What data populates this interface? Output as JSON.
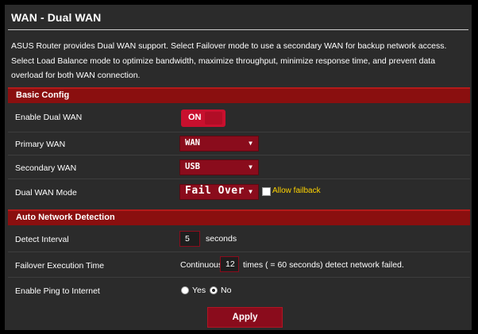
{
  "page": {
    "title": "WAN - Dual WAN",
    "description": "ASUS Router provides Dual WAN support. Select Failover mode to use a secondary WAN for backup network access. Select Load Balance mode to optimize bandwidth, maximize throughput, minimize response time, and prevent data overload for both WAN connection."
  },
  "basic_config": {
    "section_title": "Basic Config",
    "enable_dual_wan": {
      "label": "Enable Dual WAN",
      "toggle_text": "ON",
      "state": "on"
    },
    "primary_wan": {
      "label": "Primary WAN",
      "value": "WAN"
    },
    "secondary_wan": {
      "label": "Secondary WAN",
      "value": "USB"
    },
    "dual_wan_mode": {
      "label": "Dual WAN Mode",
      "value": "Fail Over",
      "allow_failback_label": "Allow failback",
      "allow_failback_checked": false
    }
  },
  "auto_network_detection": {
    "section_title": "Auto Network Detection",
    "detect_interval": {
      "label": "Detect Interval",
      "value": "5",
      "unit": "seconds"
    },
    "failover_execution_time": {
      "label": "Failover Execution Time",
      "prefix": "Continuous",
      "value": "12",
      "suffix": "times ( = 60  seconds) detect network failed."
    },
    "enable_ping": {
      "label": "Enable Ping to Internet",
      "yes_label": "Yes",
      "no_label": "No",
      "selected": "No"
    }
  },
  "actions": {
    "apply_label": "Apply"
  },
  "colors": {
    "accent": "#8a0c1c",
    "toggle": "#c8102e",
    "link": "#ffd400",
    "panel": "#2b2b2b"
  },
  "icons": {
    "select_arrow": "dropdown-arrow-icon"
  }
}
